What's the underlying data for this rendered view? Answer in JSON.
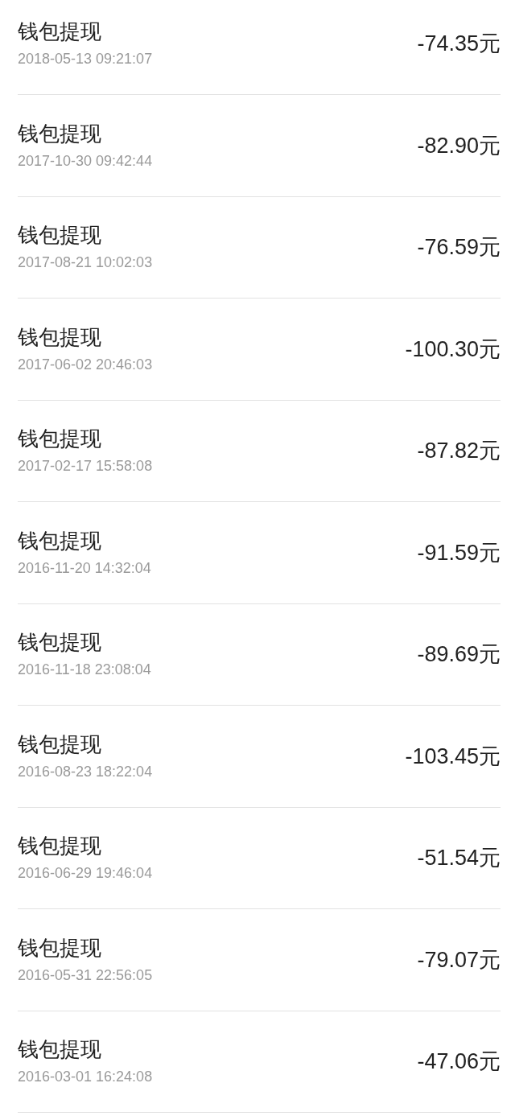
{
  "transactions": [
    {
      "title": "钱包提现",
      "time": "2018-05-13 09:21:07",
      "amount": "-74.35元"
    },
    {
      "title": "钱包提现",
      "time": "2017-10-30 09:42:44",
      "amount": "-82.90元"
    },
    {
      "title": "钱包提现",
      "time": "2017-08-21 10:02:03",
      "amount": "-76.59元"
    },
    {
      "title": "钱包提现",
      "time": "2017-06-02 20:46:03",
      "amount": "-100.30元"
    },
    {
      "title": "钱包提现",
      "time": "2017-02-17 15:58:08",
      "amount": "-87.82元"
    },
    {
      "title": "钱包提现",
      "time": "2016-11-20 14:32:04",
      "amount": "-91.59元"
    },
    {
      "title": "钱包提现",
      "time": "2016-11-18 23:08:04",
      "amount": "-89.69元"
    },
    {
      "title": "钱包提现",
      "time": "2016-08-23 18:22:04",
      "amount": "-103.45元"
    },
    {
      "title": "钱包提现",
      "time": "2016-06-29 19:46:04",
      "amount": "-51.54元"
    },
    {
      "title": "钱包提现",
      "time": "2016-05-31 22:56:05",
      "amount": "-79.07元"
    },
    {
      "title": "钱包提现",
      "time": "2016-03-01 16:24:08",
      "amount": "-47.06元"
    }
  ]
}
